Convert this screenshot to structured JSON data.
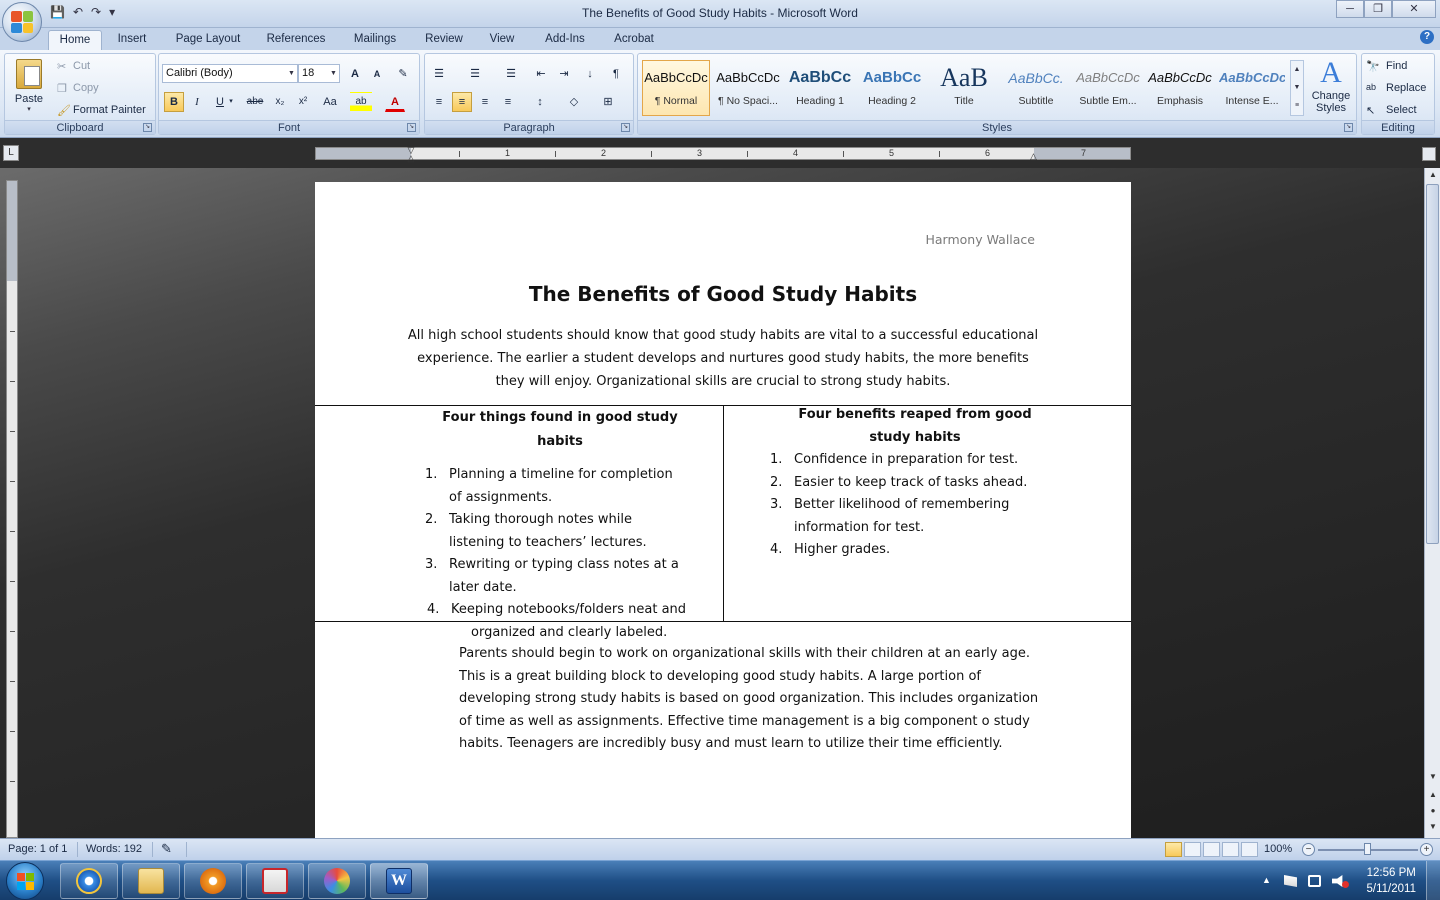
{
  "window": {
    "title": "The Benefits of Good Study Habits - Microsoft Word",
    "minimize": "─",
    "maximize": "❐",
    "close": "✕"
  },
  "qat": {
    "save": "💾",
    "undo": "↶",
    "redo": "↷",
    "customize": "▾"
  },
  "ribbon_tabs": [
    "Home",
    "Insert",
    "Page Layout",
    "References",
    "Mailings",
    "Review",
    "View",
    "Add-Ins",
    "Acrobat"
  ],
  "clipboard": {
    "paste": "Paste",
    "cut": "Cut",
    "copy": "Copy",
    "format_painter": "Format Painter",
    "label": "Clipboard"
  },
  "font": {
    "family": "Calibri (Body)",
    "size": "18",
    "grow": "A",
    "shrink": "A",
    "clear": "✎",
    "bold": "B",
    "italic": "I",
    "underline": "U",
    "strike": "abe",
    "subscript": "x₂",
    "superscript": "x²",
    "change_case": "Aa",
    "highlight": "ab",
    "font_color": "A",
    "label": "Font"
  },
  "paragraph": {
    "bullets": "☰",
    "numbering": "☰",
    "multilevel": "☰",
    "decrease_indent": "⇤",
    "increase_indent": "⇥",
    "sort": "↓",
    "show_marks": "¶",
    "align_left": "≡",
    "align_center": "≡",
    "align_right": "≡",
    "justify": "≡",
    "line_spacing": "↕",
    "shading": "◇",
    "borders": "⊞",
    "label": "Paragraph"
  },
  "styles": {
    "items": [
      {
        "sample": "AaBbCcDc",
        "name": "¶ Normal"
      },
      {
        "sample": "AaBbCcDc",
        "name": "¶ No Spaci..."
      },
      {
        "sample": "AaBbCc",
        "name": "Heading 1"
      },
      {
        "sample": "AaBbCc",
        "name": "Heading 2"
      },
      {
        "sample": "AaB",
        "name": "Title"
      },
      {
        "sample": "AaBbCc.",
        "name": "Subtitle"
      },
      {
        "sample": "AaBbCcDc",
        "name": "Subtle Em..."
      },
      {
        "sample": "AaBbCcDc",
        "name": "Emphasis"
      },
      {
        "sample": "AaBbCcDc",
        "name": "Intense E..."
      }
    ],
    "change_styles_line1": "Change",
    "change_styles_line2": "Styles",
    "label": "Styles"
  },
  "editing": {
    "find": "Find",
    "replace": "Replace",
    "select": "Select",
    "label": "Editing"
  },
  "ruler_numbers": [
    "1",
    "2",
    "3",
    "4",
    "5",
    "6",
    "7"
  ],
  "document": {
    "header_name": "Harmony Wallace",
    "title": "The Benefits of Good Study Habits",
    "intro_lines": [
      "All high school students should know that good study habits are vital to a successful educational",
      "experience. The earlier a student develops and nurtures good study habits, the more benefits",
      "they will enjoy. Organizational skills are crucial to strong study habits."
    ],
    "left_col": {
      "heading": "Four things found in good study habits",
      "items": [
        {
          "n": "1.",
          "lines": [
            "Planning a timeline for completion",
            "of assignments."
          ]
        },
        {
          "n": "2.",
          "lines": [
            "Taking thorough notes while",
            "listening to teachers’ lectures."
          ]
        },
        {
          "n": "3.",
          "lines": [
            "Rewriting or typing class notes at a",
            "later date."
          ]
        },
        {
          "n": "4.",
          "lines": [
            "Keeping notebooks/folders neat and",
            "organized and clearly labeled."
          ]
        }
      ]
    },
    "right_col": {
      "heading_lines": [
        "Four benefits reaped from good",
        "study habits"
      ],
      "items": [
        {
          "n": "1.",
          "lines": [
            "Confidence in preparation for test."
          ]
        },
        {
          "n": "2.",
          "lines": [
            "Easier to keep track of tasks ahead."
          ]
        },
        {
          "n": "3.",
          "lines": [
            "Better likelihood of remembering",
            "information for test."
          ]
        },
        {
          "n": "4.",
          "lines": [
            "Higher grades."
          ]
        }
      ]
    },
    "closing_lines": [
      "Parents should begin to work on organizational skills with their children at an early age.",
      "This is a great building block to developing good study habits. A large portion of",
      "developing strong study habits is based on good organization. This includes organization",
      "of time as well as assignments. Effective time management is a big component  o study",
      "habits. Teenagers are incredibly busy and must learn to utilize their time efficiently."
    ]
  },
  "status": {
    "page": "Page: 1 of 1",
    "words": "Words: 192",
    "zoom": "100%",
    "zoom_out": "−",
    "zoom_in": "+"
  },
  "taskbar": {
    "time": "12:56 PM",
    "date": "5/11/2011"
  },
  "colors": {
    "ribbon": "#dbe6f4",
    "taskbar": "#1f4f86",
    "accent": "#f8c95a"
  }
}
